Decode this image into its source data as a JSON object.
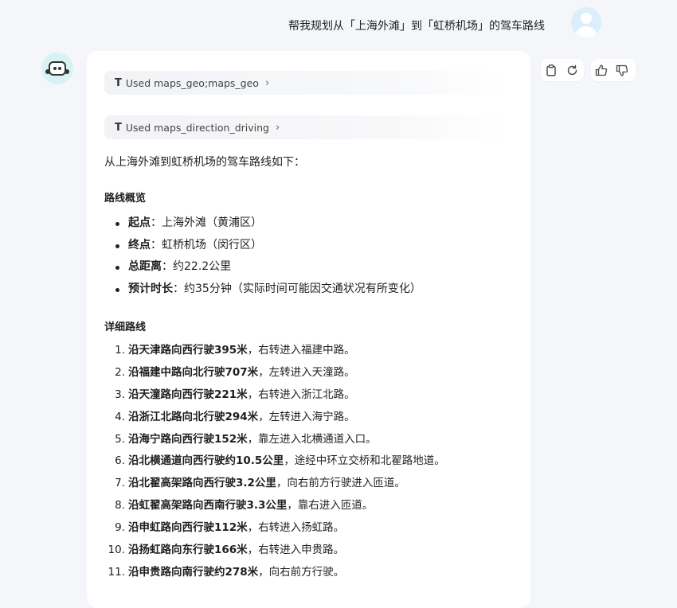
{
  "user_message": "帮我规划从「上海外滩」到「虹桥机场」的驾车路线",
  "tools": [
    {
      "label": "Used maps_geo;maps_geo"
    },
    {
      "label": "Used maps_direction_driving"
    }
  ],
  "intro": "从上海外滩到虹桥机场的驾车路线如下：",
  "overview": {
    "heading": "路线概览",
    "items": [
      {
        "label": "起点",
        "value": "：上海外滩（黄浦区）"
      },
      {
        "label": "终点",
        "value": "：虹桥机场（闵行区）"
      },
      {
        "label": "总距离",
        "value": "：约22.2公里"
      },
      {
        "label": "预计时长",
        "value": "：约35分钟（实际时间可能因交通状况有所变化）"
      }
    ]
  },
  "details": {
    "heading": "详细路线",
    "steps": [
      {
        "num": "1.",
        "bold": "沿天津路向西行驶395米",
        "rest": "，右转进入福建中路。"
      },
      {
        "num": "2.",
        "bold": "沿福建中路向北行驶707米",
        "rest": "，左转进入天潼路。"
      },
      {
        "num": "3.",
        "bold": "沿天潼路向西行驶221米",
        "rest": "，右转进入浙江北路。"
      },
      {
        "num": "4.",
        "bold": "沿浙江北路向北行驶294米",
        "rest": "，左转进入海宁路。"
      },
      {
        "num": "5.",
        "bold": "沿海宁路向西行驶152米",
        "rest": "，靠左进入北横通道入口。"
      },
      {
        "num": "6.",
        "bold": "沿北横通道向西行驶约10.5公里",
        "rest": "，途经中环立交桥和北翟路地道。"
      },
      {
        "num": "7.",
        "bold": "沿北翟高架路向西行驶3.2公里",
        "rest": "，向右前方行驶进入匝道。"
      },
      {
        "num": "8.",
        "bold": "沿虹翟高架路向西南行驶3.3公里",
        "rest": "，靠右进入匝道。"
      },
      {
        "num": "9.",
        "bold": "沿申虹路向西行驶112米",
        "rest": "，右转进入扬虹路。"
      },
      {
        "num": "10.",
        "bold": "沿扬虹路向东行驶166米",
        "rest": "，右转进入申贵路。"
      },
      {
        "num": "11.",
        "bold": "沿申贵路向南行驶约278米",
        "rest": "，向右前方行驶。"
      }
    ]
  },
  "action_icons": [
    "copy-icon",
    "refresh-icon",
    "thumbs-up-icon",
    "thumbs-down-icon"
  ]
}
